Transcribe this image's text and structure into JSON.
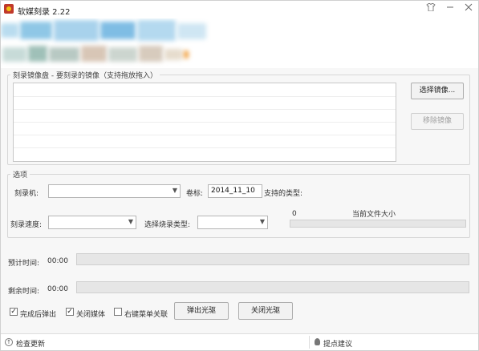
{
  "window": {
    "title": "软媒刻录 2.22"
  },
  "image_group": {
    "label": "刻录镜像盘 - 要刻录的镜像（支持拖放拖入）",
    "select_button": "选择镜像...",
    "remove_button": "移除镜像"
  },
  "options": {
    "label": "选项",
    "burner_label": "刻录机:",
    "volume_label": "卷标:",
    "volume_value": "2014_11_10",
    "supported_type_label": "支持的类型:",
    "speed_label": "刻录速度:",
    "burn_type_label": "选择烧录类型:",
    "size_value": "0",
    "size_label": "当前文件大小"
  },
  "progress": {
    "estimated_label": "预计时间:",
    "estimated_value": "00:00",
    "remaining_label": "剩余时间:",
    "remaining_value": "00:00"
  },
  "bottom": {
    "eject_after_label": "完成后弹出",
    "eject_after_checked": true,
    "close_media_label": "关闭媒体",
    "close_media_checked": true,
    "context_menu_label": "右键菜单关联",
    "context_menu_checked": false,
    "eject_button": "弹出光驱",
    "close_tray_button": "关闭光驱"
  },
  "statusbar": {
    "check_update": "检查更新",
    "feedback": "提点建议"
  },
  "icons": [
    "app-icon",
    "clothes-icon",
    "minimize-icon",
    "close-icon",
    "update-icon",
    "bulb-icon",
    "chevron-down-icon",
    "check-icon"
  ]
}
